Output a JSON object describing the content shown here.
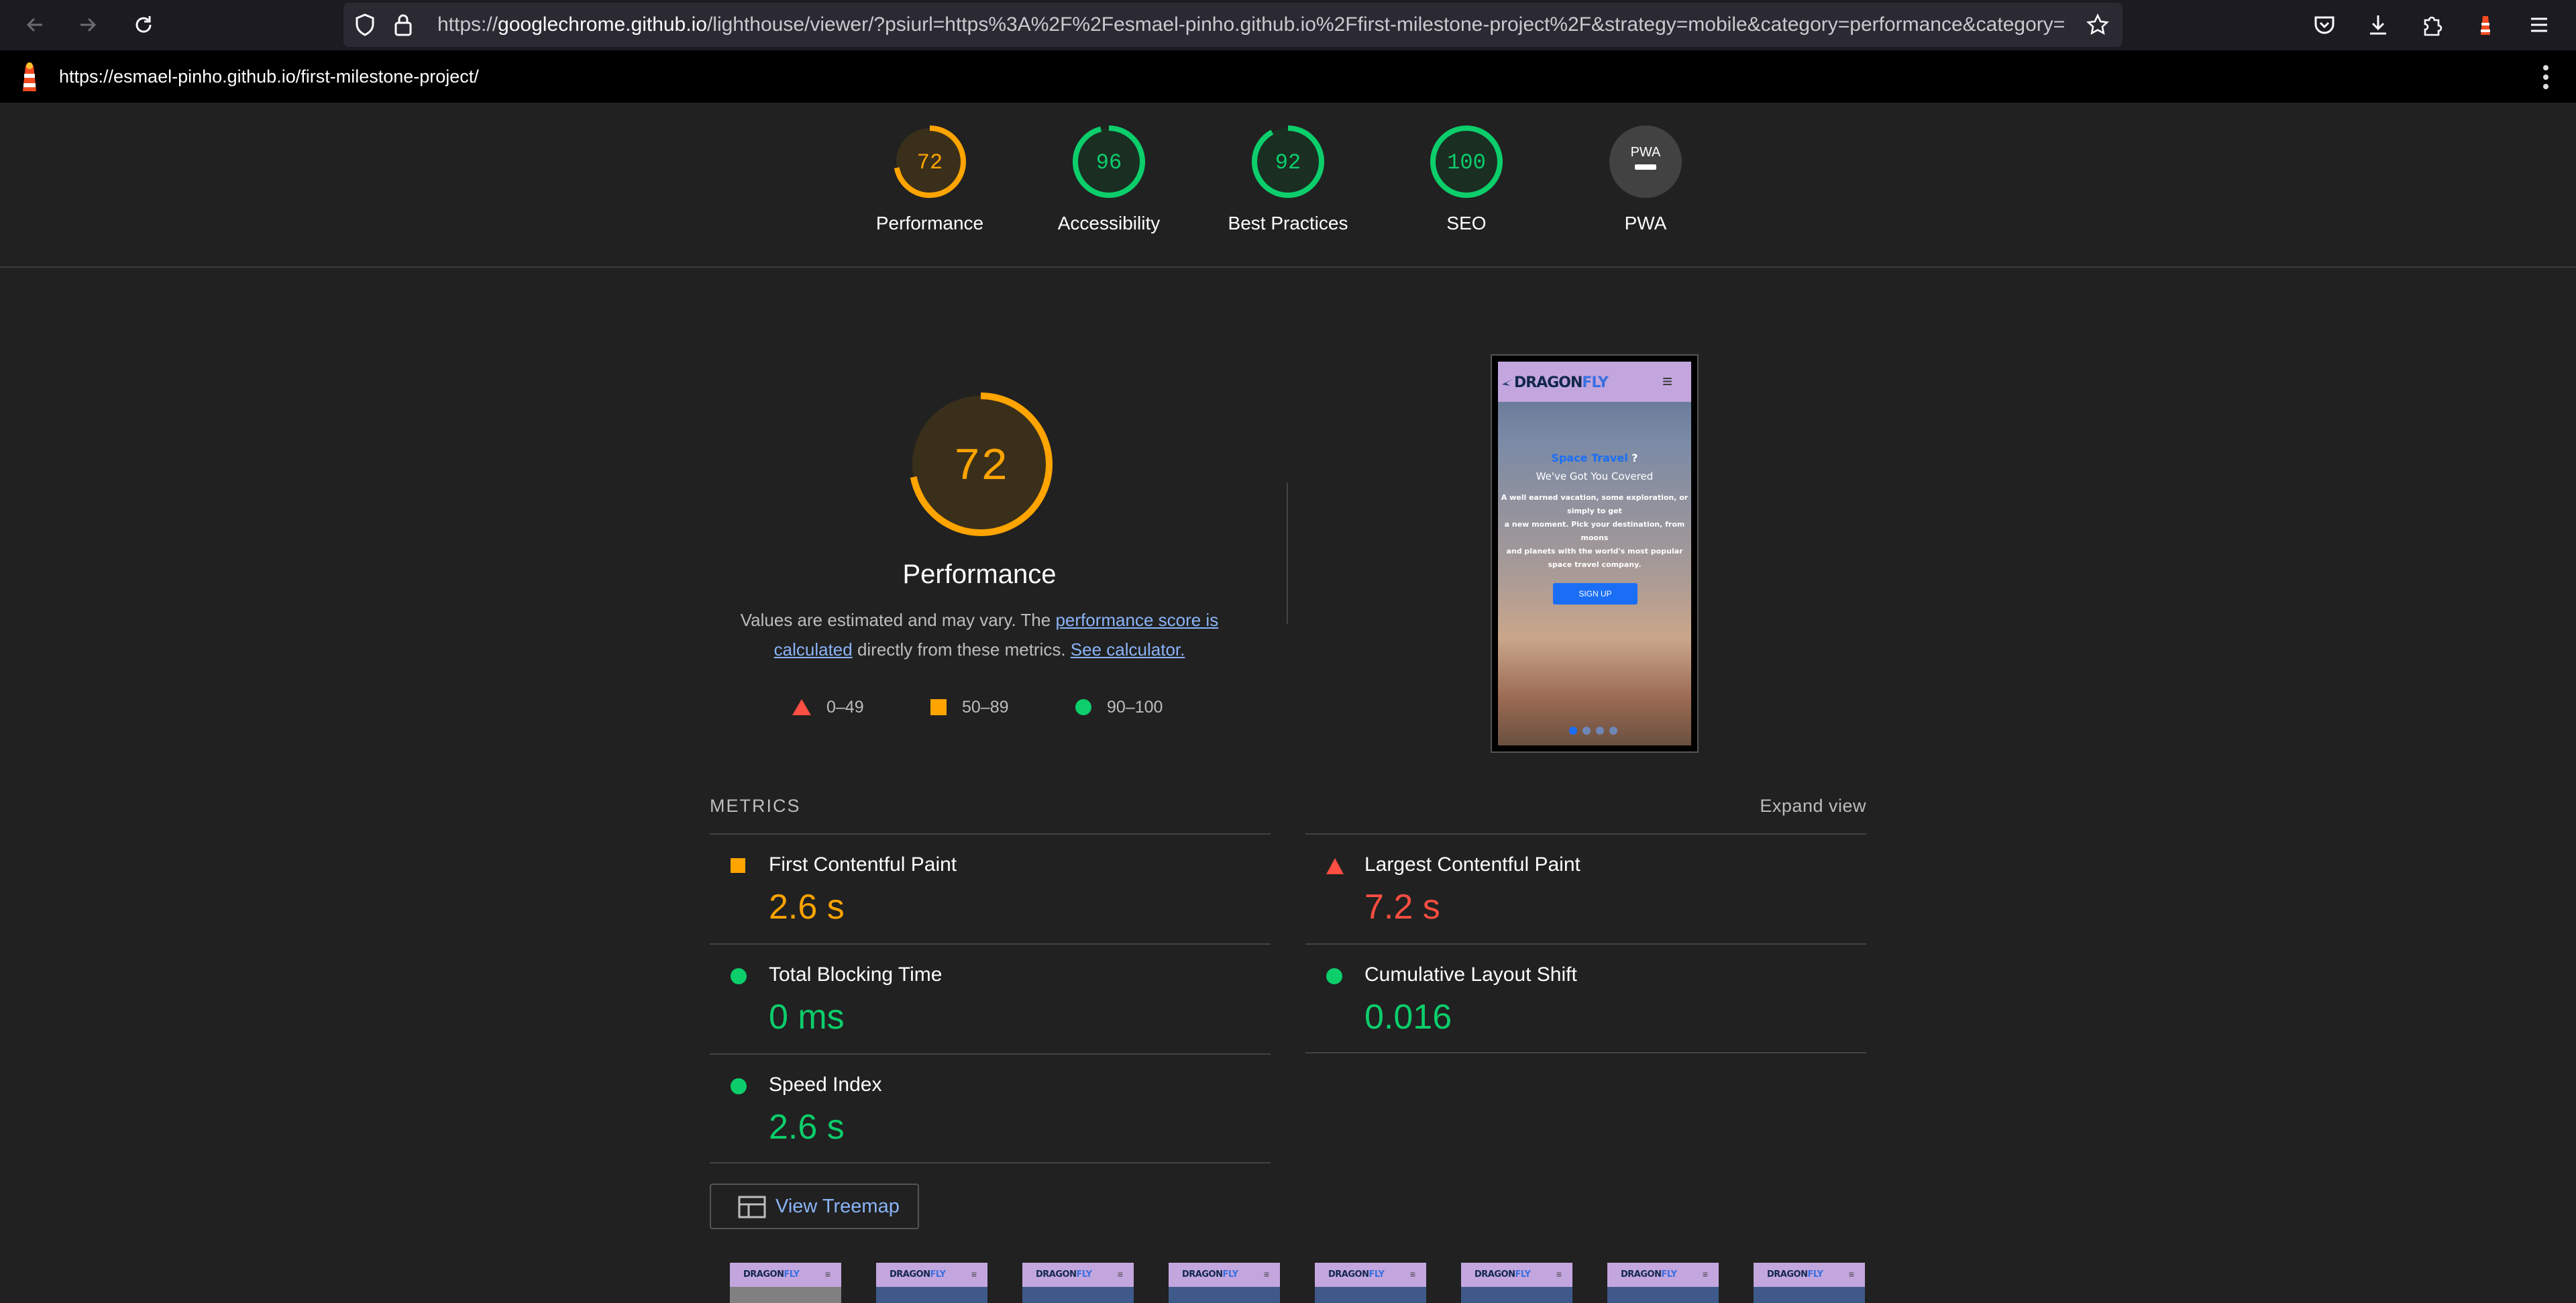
{
  "browser": {
    "url_prefix": "https://",
    "url_host": "googlechrome.github.io",
    "url_rest": "/lighthouse/viewer/?psiurl=https%3A%2F%2Fesmael-pinho.github.io%2Ffirst-milestone-project%2F&strategy=mobile&category=performance&category=",
    "icons": [
      "back-arrow-icon",
      "forward-arrow-icon",
      "reload-icon",
      "shield-icon",
      "lock-icon",
      "star-icon",
      "pocket-icon",
      "download-icon",
      "extensions-icon",
      "lighthouse-extension-icon",
      "menu-icon"
    ]
  },
  "lighthouse_topbar": {
    "report_url": "https://esmael-pinho.github.io/first-milestone-project/"
  },
  "gauges": [
    {
      "score": "72",
      "label": "Performance",
      "value": 0.72,
      "color": "#ffa400"
    },
    {
      "score": "96",
      "label": "Accessibility",
      "value": 0.96,
      "color": "#0cce6b"
    },
    {
      "score": "92",
      "label": "Best Practices",
      "value": 0.92,
      "color": "#0cce6b"
    },
    {
      "score": "100",
      "label": "SEO",
      "value": 1.0,
      "color": "#0cce6b"
    },
    {
      "score": "PWA",
      "label": "PWA",
      "value": 0,
      "color": "#9e9e9e"
    }
  ],
  "performance": {
    "score": "72",
    "value": 0.72,
    "title": "Performance",
    "desc_part1": "Values are estimated and may vary. The ",
    "desc_link1": "performance score is calculated",
    "desc_part2": " directly from these metrics. ",
    "desc_link2": "See calculator."
  },
  "legend": [
    {
      "range": "0–49",
      "color": "#ff4e42",
      "shape": "triangle"
    },
    {
      "range": "50–89",
      "color": "#ffa400",
      "shape": "square"
    },
    {
      "range": "90–100",
      "color": "#0cce6b",
      "shape": "circle"
    }
  ],
  "screenshot": {
    "logo_a": "DRAGON",
    "logo_b": "FLY",
    "menu": "≡",
    "heading_a": "Space Travel",
    "heading_b": " ?",
    "subheading": "We've Got You Covered",
    "line1": "A well earned vacation, some exploration, or",
    "line2": "simply to get",
    "line3": "a new moment. Pick your destination, from",
    "line4": "moons",
    "line5": "and planets with the world's most popular",
    "line6": "space travel company.",
    "signup": "SIGN UP"
  },
  "metrics": {
    "title": "METRICS",
    "expand": "Expand view",
    "items": [
      {
        "name": "First Contentful Paint",
        "value": "2.6 s",
        "rating": "average",
        "color": "#ffa400"
      },
      {
        "name": "Largest Contentful Paint",
        "value": "7.2 s",
        "rating": "fail",
        "color": "#ff4e42"
      },
      {
        "name": "Total Blocking Time",
        "value": "0 ms",
        "rating": "pass",
        "color": "#0cce6b"
      },
      {
        "name": "Cumulative Layout Shift",
        "value": "0.016",
        "rating": "pass",
        "color": "#0cce6b"
      },
      {
        "name": "Speed Index",
        "value": "2.6 s",
        "rating": "pass",
        "color": "#0cce6b"
      }
    ]
  },
  "treemap_button": {
    "label": "View Treemap"
  },
  "thumbnails": {
    "logo_a": "DRAGON",
    "logo_b": "FLY",
    "close": "≡"
  }
}
